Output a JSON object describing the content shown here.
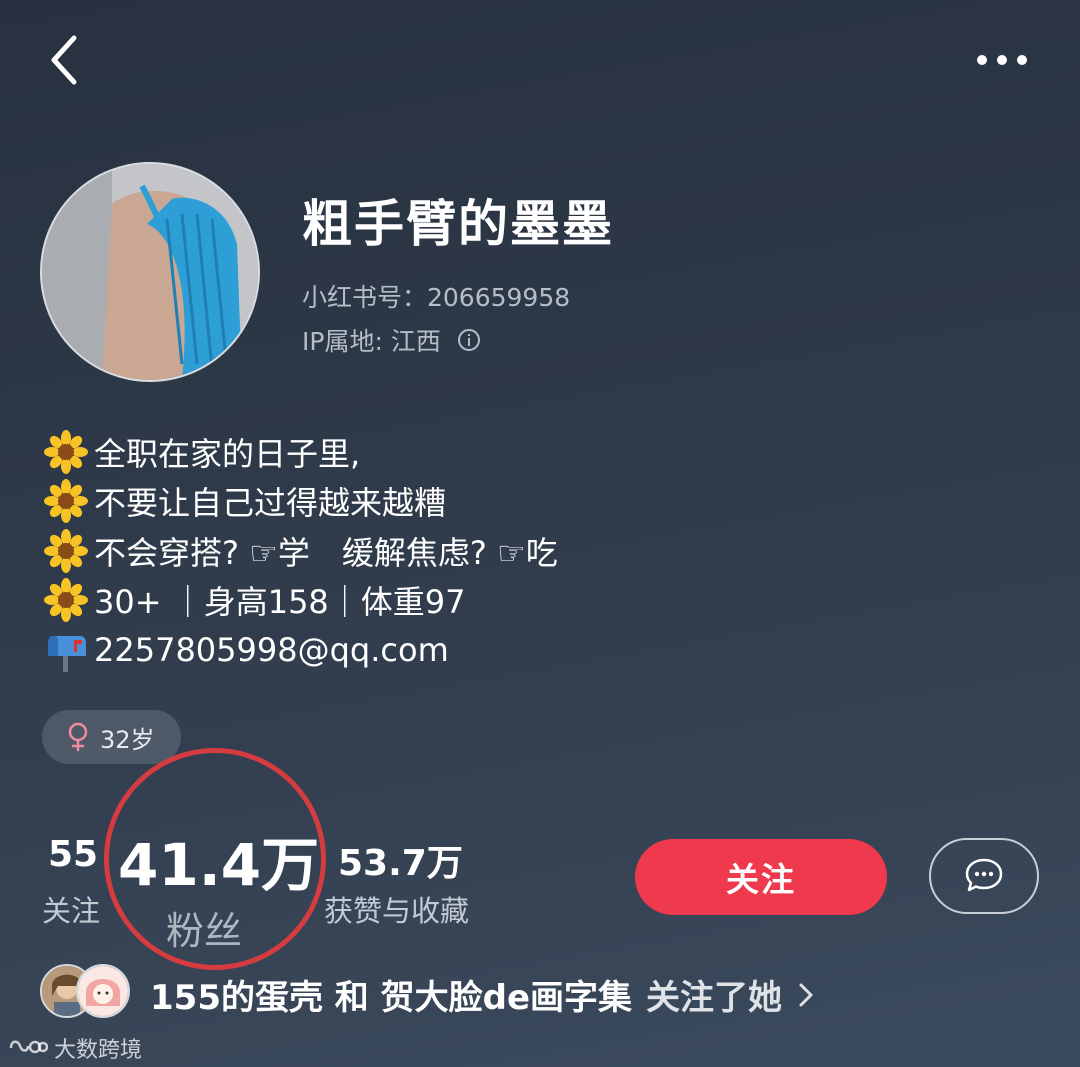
{
  "header": {
    "back_icon": "chevron-left-icon",
    "more_icon": "ellipsis-icon"
  },
  "profile": {
    "name": "粗手臂的墨墨",
    "id_label": "小红书号：206659958",
    "ip_label": "IP属地: 江西",
    "info_icon": "info-icon"
  },
  "bio": {
    "lines": [
      {
        "icon": "sunflower-icon",
        "text": "全职在家的日子里,"
      },
      {
        "icon": "sunflower-icon",
        "text": "不要让自己过得越来越糟"
      },
      {
        "icon": "sunflower-icon",
        "text": "不会穿搭? ☞学　缓解焦虑? ☞吃"
      },
      {
        "icon": "sunflower-icon",
        "text": "30+ ｜身高158｜体重97"
      },
      {
        "icon": "mailbox-icon",
        "text": "2257805998@qq.com"
      }
    ]
  },
  "tag": {
    "icon": "female-icon",
    "text": "32岁"
  },
  "stats": {
    "following_value": "55",
    "following_label": "关注",
    "fans_value": "41.4万",
    "fans_label": "粉丝",
    "likes_value": "53.7万",
    "likes_label": "获赞与收藏"
  },
  "actions": {
    "follow_label": "关注",
    "chat_icon": "chat-bubble-icon"
  },
  "followed_by": {
    "text": "155的蛋壳 和 贺大脸de画字集",
    "suffix": "关注了她",
    "chevron_icon": "chevron-right-icon"
  },
  "watermark": {
    "text": "大数跨境"
  },
  "colors": {
    "accent": "#ee3a4c",
    "highlight_circle": "#d63c3f",
    "background_top": "#27313f",
    "background_bottom": "#3b4a5d"
  }
}
